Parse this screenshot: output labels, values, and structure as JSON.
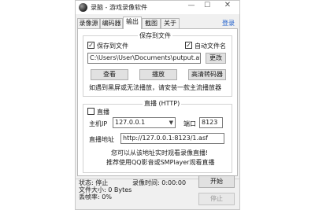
{
  "window": {
    "title": "录脑 - 游戏录像软件",
    "minimize_glyph": "—",
    "maximize_glyph": "☐",
    "close_glyph": "✕"
  },
  "tabs": [
    {
      "label": "录像源"
    },
    {
      "label": "编码器"
    },
    {
      "label": "输出",
      "active": true
    },
    {
      "label": "截图"
    },
    {
      "label": "关于"
    }
  ],
  "login_label": "登录",
  "save_group": {
    "title": "保存到文件",
    "save_to_file_label": "保存到文件",
    "save_to_file_checked": true,
    "auto_filename_label": "自动文件名",
    "auto_filename_checked": true,
    "path_value": "C:\\Users\\User\\Documents\\putput.avi",
    "change_button": "更改",
    "view_button": "查看",
    "play_button": "播放",
    "hd_converter_button": "高清转码器",
    "notice": "如遇到黑屏或无法播放，请安装一款主流播放器"
  },
  "live_group": {
    "title": "直播 (HTTP)",
    "live_label": "直播",
    "live_checked": false,
    "host_ip_label": "主机IP",
    "host_ip_value": "127.0.0.1",
    "port_label": "端口",
    "port_value": "8123",
    "address_label": "直播地址",
    "address_value": "http://127.0.0.1:8123/1.asf",
    "hint_line1": "您可以从该地址实时观看录像直播!",
    "hint_line2": "推荐使用QQ影音或SMPlayer观看直播"
  },
  "status": {
    "state": "状态: 停止",
    "record_time": "录像时间: 0:00:00",
    "file_size": "文件大小: 0 Bytes",
    "frame_loss": "丢帧率: 0%"
  },
  "buttons": {
    "start": "开始",
    "stop": "停止"
  },
  "checkmark_glyph": "✓",
  "combo_arrow_glyph": "▼"
}
